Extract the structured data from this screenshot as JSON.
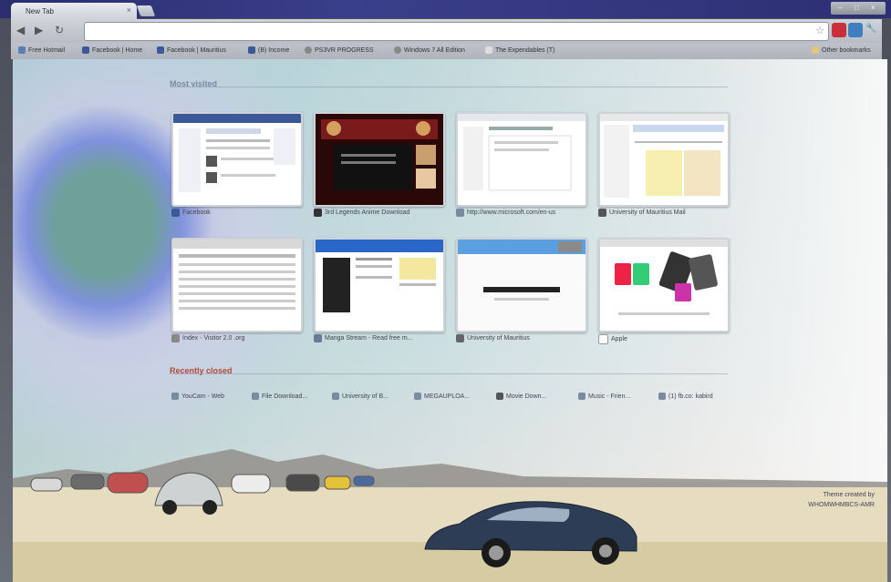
{
  "window": {
    "tab_title": "New Tab",
    "tab_close": "×",
    "controls": [
      "–",
      "□",
      "×"
    ]
  },
  "toolbar": {
    "back": "◀",
    "forward": "▶",
    "reload": "↻",
    "star": "☆",
    "wrench": "🔧"
  },
  "bookmarks": [
    {
      "label": "Free Hotmail",
      "color": "#5a7fb0"
    },
    {
      "label": "Facebook | Home",
      "color": "#3b5998"
    },
    {
      "label": "Facebook | Mauritius",
      "color": "#3b5998"
    },
    {
      "label": "(B) Income",
      "color": "#3b5998"
    },
    {
      "label": "PS3VR PROGRESS",
      "color": "#888888"
    },
    {
      "label": "Windows 7 All Edition",
      "color": "#888888"
    },
    {
      "label": "The Expendables (T)",
      "color": "#dddddd"
    },
    {
      "label": "Other bookmarks",
      "color": "#e3c47a"
    }
  ],
  "most_visited": {
    "title": "Most visited",
    "items": [
      {
        "label": "Facebook",
        "fav_color": "#3b5998",
        "theme": "facebook"
      },
      {
        "label": "3rd Legends Anime Download",
        "fav_color": "#333333",
        "theme": "anime"
      },
      {
        "label": "http://www.microsoft.com/en-us",
        "fav_color": "#7a8aa0",
        "theme": "doc"
      },
      {
        "label": "University of Mauritius Mail",
        "fav_color": "#555555",
        "theme": "mail"
      },
      {
        "label": "Index - Visitor 2.0 .org",
        "fav_color": "#888888",
        "theme": "forum"
      },
      {
        "label": "Manga Stream - Read free m...",
        "fav_color": "#6a7a9a",
        "theme": "manga"
      },
      {
        "label": "University of Mauritius",
        "fav_color": "#666666",
        "theme": "uom"
      },
      {
        "label": "Apple",
        "fav_color": "#ffffff",
        "theme": "apple"
      }
    ]
  },
  "recently_closed": {
    "title": "Recently closed",
    "items": [
      {
        "label": "YouCam - Web"
      },
      {
        "label": "File Download..."
      },
      {
        "label": "University of B..."
      },
      {
        "label": "MEGAUPLOA..."
      },
      {
        "label": "Movie Down..."
      },
      {
        "label": "Music - Frien..."
      },
      {
        "label": "(1) fb.co: kabird"
      }
    ]
  },
  "credit": {
    "line1": "Theme created by",
    "line2": "WHOMWHMBCS-AMR"
  }
}
